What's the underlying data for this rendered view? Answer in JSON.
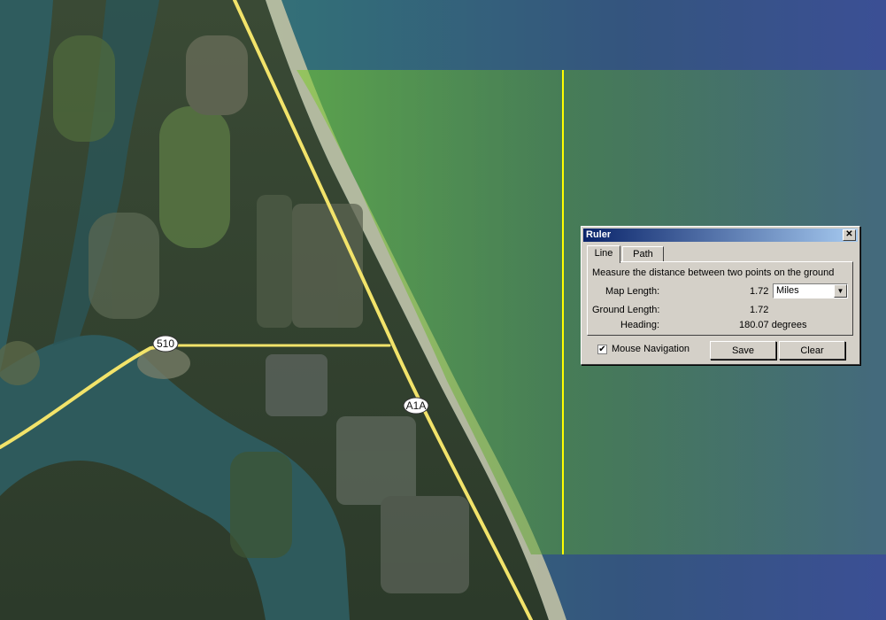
{
  "map": {
    "road_labels": [
      {
        "id": "road-510",
        "text": "510"
      },
      {
        "id": "road-a1a",
        "text": "A1A"
      }
    ],
    "colors": {
      "ocean": "#2f6a78",
      "ocean_deep": "#3a4f8f",
      "land": "#2f3e2c",
      "road": "#f2e36a",
      "overlay": "#7fbf3a",
      "ruler_line": "#ffff00"
    }
  },
  "ruler": {
    "title": "Ruler",
    "close_symbol": "✕",
    "tabs": [
      {
        "label": "Line",
        "active": true
      },
      {
        "label": "Path",
        "active": false
      }
    ],
    "instruction": "Measure the distance between two points on the ground",
    "map_length_label": "Map Length:",
    "map_length_value": "1.72",
    "unit_selected": "Miles",
    "ground_length_label": "Ground Length:",
    "ground_length_value": "1.72",
    "heading_label": "Heading:",
    "heading_value": "180.07 degrees",
    "mouse_nav_label": "Mouse Navigation",
    "mouse_nav_checked": true,
    "save_label": "Save",
    "clear_label": "Clear"
  }
}
